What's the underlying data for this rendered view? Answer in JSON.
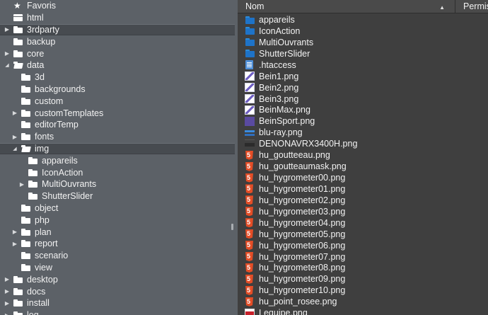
{
  "tree": {
    "items": [
      {
        "label": "Favoris",
        "icon": "star-icon",
        "level": 0,
        "arrow": "",
        "selected": false
      },
      {
        "label": "html",
        "icon": "drive-icon",
        "level": 0,
        "arrow": "",
        "selected": false
      },
      {
        "label": "3rdparty",
        "icon": "folder-icon",
        "level": 0,
        "arrow": "collapsed",
        "selected": true
      },
      {
        "label": "backup",
        "icon": "folder-icon",
        "level": 0,
        "arrow": "",
        "selected": false
      },
      {
        "label": "core",
        "icon": "folder-icon",
        "level": 0,
        "arrow": "collapsed",
        "selected": false
      },
      {
        "label": "data",
        "icon": "folder-open-icon",
        "level": 0,
        "arrow": "expanded",
        "selected": false
      },
      {
        "label": "3d",
        "icon": "folder-icon",
        "level": 1,
        "arrow": "",
        "selected": false
      },
      {
        "label": "backgrounds",
        "icon": "folder-icon",
        "level": 1,
        "arrow": "",
        "selected": false
      },
      {
        "label": "custom",
        "icon": "folder-icon",
        "level": 1,
        "arrow": "",
        "selected": false
      },
      {
        "label": "customTemplates",
        "icon": "folder-icon",
        "level": 1,
        "arrow": "collapsed",
        "selected": false
      },
      {
        "label": "editorTemp",
        "icon": "folder-icon",
        "level": 1,
        "arrow": "",
        "selected": false
      },
      {
        "label": "fonts",
        "icon": "folder-icon",
        "level": 1,
        "arrow": "collapsed",
        "selected": false
      },
      {
        "label": "img",
        "icon": "folder-open-icon",
        "level": 1,
        "arrow": "expanded",
        "selected": true
      },
      {
        "label": "appareils",
        "icon": "folder-icon",
        "level": 2,
        "arrow": "",
        "selected": false
      },
      {
        "label": "IconAction",
        "icon": "folder-icon",
        "level": 2,
        "arrow": "",
        "selected": false
      },
      {
        "label": "MultiOuvrants",
        "icon": "folder-icon",
        "level": 2,
        "arrow": "collapsed",
        "selected": false
      },
      {
        "label": "ShutterSlider",
        "icon": "folder-icon",
        "level": 2,
        "arrow": "",
        "selected": false
      },
      {
        "label": "object",
        "icon": "folder-icon",
        "level": 1,
        "arrow": "",
        "selected": false
      },
      {
        "label": "php",
        "icon": "folder-icon",
        "level": 1,
        "arrow": "",
        "selected": false
      },
      {
        "label": "plan",
        "icon": "folder-icon",
        "level": 1,
        "arrow": "collapsed",
        "selected": false
      },
      {
        "label": "report",
        "icon": "folder-icon",
        "level": 1,
        "arrow": "collapsed",
        "selected": false
      },
      {
        "label": "scenario",
        "icon": "folder-icon",
        "level": 1,
        "arrow": "",
        "selected": false
      },
      {
        "label": "view",
        "icon": "folder-icon",
        "level": 1,
        "arrow": "",
        "selected": false
      },
      {
        "label": "desktop",
        "icon": "folder-icon",
        "level": 0,
        "arrow": "collapsed",
        "selected": false
      },
      {
        "label": "docs",
        "icon": "folder-icon",
        "level": 0,
        "arrow": "collapsed",
        "selected": false
      },
      {
        "label": "install",
        "icon": "folder-icon",
        "level": 0,
        "arrow": "collapsed",
        "selected": false
      },
      {
        "label": "log",
        "icon": "folder-icon",
        "level": 0,
        "arrow": "collapsed",
        "selected": false
      }
    ]
  },
  "list": {
    "header": {
      "name": "Nom",
      "permissions": "Permis"
    },
    "files": [
      {
        "label": "appareils",
        "icon": "folder"
      },
      {
        "label": "IconAction",
        "icon": "folder"
      },
      {
        "label": "MultiOuvrants",
        "icon": "folder"
      },
      {
        "label": "ShutterSlider",
        "icon": "folder"
      },
      {
        "label": ".htaccess",
        "icon": "doc"
      },
      {
        "label": "Bein1.png",
        "icon": "thumb-leg"
      },
      {
        "label": "Bein2.png",
        "icon": "thumb-leg"
      },
      {
        "label": "Bein3.png",
        "icon": "thumb-leg"
      },
      {
        "label": "BeinMax.png",
        "icon": "thumb-leg"
      },
      {
        "label": "BeinSport.png",
        "icon": "thumb-purple"
      },
      {
        "label": "blu-ray.png",
        "icon": "thumb-blue"
      },
      {
        "label": "DENONAVRX3400H.png",
        "icon": "thumb-dark"
      },
      {
        "label": "hu_goutteeau.png",
        "icon": "html5"
      },
      {
        "label": "hu_goutteaumask.png",
        "icon": "html5"
      },
      {
        "label": "hu_hygrometer00.png",
        "icon": "html5"
      },
      {
        "label": "hu_hygrometer01.png",
        "icon": "html5"
      },
      {
        "label": "hu_hygrometer02.png",
        "icon": "html5"
      },
      {
        "label": "hu_hygrometer03.png",
        "icon": "html5"
      },
      {
        "label": "hu_hygrometer04.png",
        "icon": "html5"
      },
      {
        "label": "hu_hygrometer05.png",
        "icon": "html5"
      },
      {
        "label": "hu_hygrometer06.png",
        "icon": "html5"
      },
      {
        "label": "hu_hygrometer07.png",
        "icon": "html5"
      },
      {
        "label": "hu_hygrometer08.png",
        "icon": "html5"
      },
      {
        "label": "hu_hygrometer09.png",
        "icon": "html5"
      },
      {
        "label": "hu_hygrometer10.png",
        "icon": "html5"
      },
      {
        "label": "hu_point_rosee.png",
        "icon": "html5"
      },
      {
        "label": "Lequipe.png",
        "icon": "thumb-red"
      }
    ]
  }
}
